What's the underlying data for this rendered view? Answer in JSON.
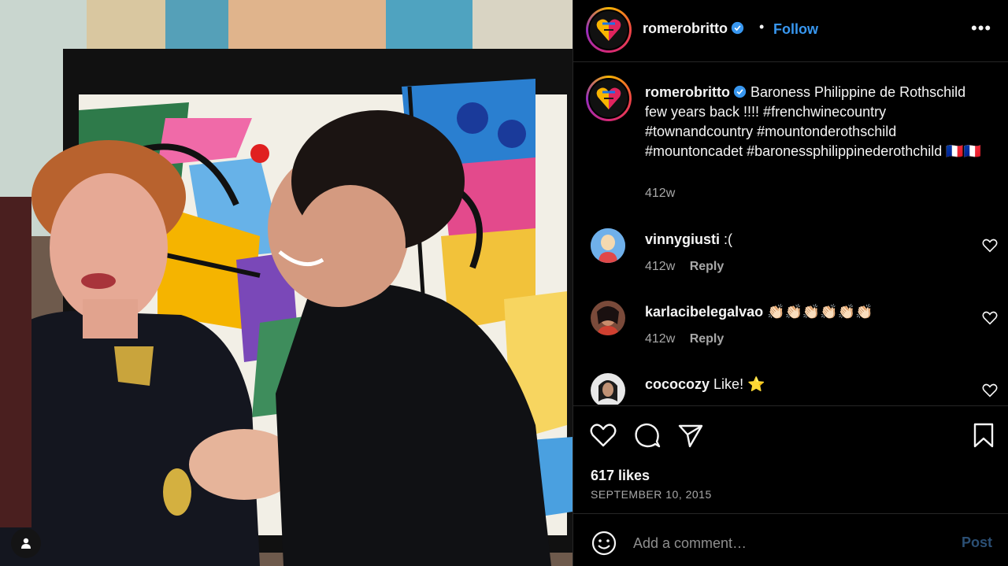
{
  "post": {
    "photo_alt": "",
    "tag_icon": "user-tag-icon"
  },
  "header": {
    "username": "romerobritto",
    "verified": true,
    "separator": "•",
    "follow_label": "Follow",
    "more_label": "•••"
  },
  "caption": {
    "username": "romerobritto",
    "text": "Baroness Philippine de Rothschild few years back !!!! #frenchwinecountry #townandcountry #mountonderothschild #mountoncadet #baronessphilippinederothchild 🇫🇷🇫🇷",
    "time": "412w"
  },
  "comments": [
    {
      "username": "vinnygiusti",
      "text": ":(",
      "time": "412w",
      "reply_label": "Reply"
    },
    {
      "username": "karlacibelegalvao",
      "text": "👏🏻👏🏻👏🏻👏🏻👏🏻👏🏻",
      "time": "412w",
      "reply_label": "Reply"
    },
    {
      "username": "cococozy",
      "text": "Like! ⭐",
      "time": "",
      "reply_label": ""
    }
  ],
  "actions": {
    "likes": "617 likes",
    "date": "SEPTEMBER 10, 2015",
    "icons": [
      "heart-icon",
      "comment-icon",
      "share-icon",
      "bookmark-icon"
    ]
  },
  "add_comment": {
    "placeholder": "Add a comment…",
    "post_label": "Post"
  },
  "colors": {
    "background": "#000000",
    "link_blue": "#3897f0",
    "muted": "#a8a8a8",
    "post_disabled": "#2b4f74"
  }
}
